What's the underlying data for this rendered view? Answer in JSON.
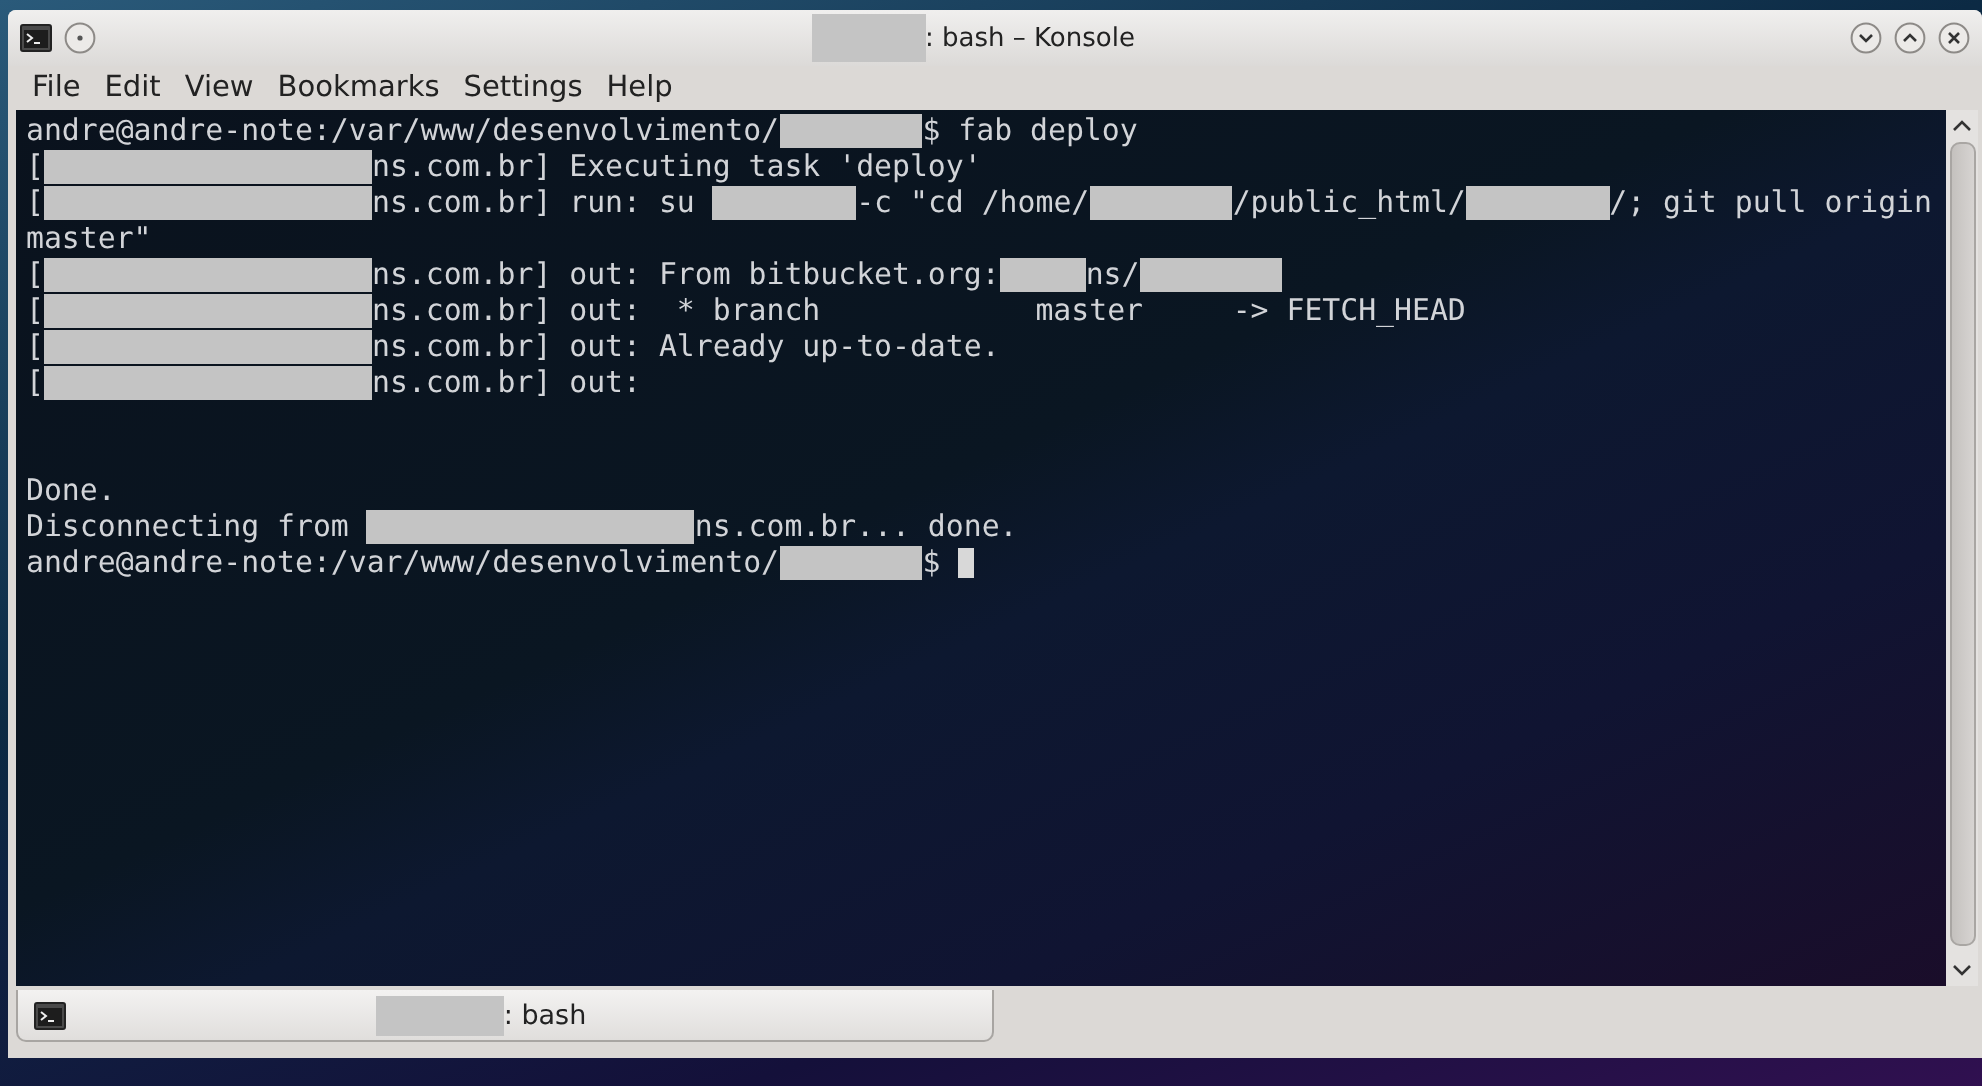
{
  "window": {
    "title": {
      "redacted": true,
      "text": ": bash – Konsole"
    }
  },
  "menu": [
    "File",
    "Edit",
    "View",
    "Bookmarks",
    "Settings",
    "Help"
  ],
  "terminal": {
    "lines": [
      {
        "kind": "text",
        "segments": [
          {
            "kind": "text",
            "text": "andre@andre-note:/var/www/desenvolvimento/"
          },
          {
            "kind": "redacted_medium"
          },
          {
            "kind": "text",
            "text": "$ fab deploy"
          }
        ]
      },
      {
        "kind": "text",
        "segments": [
          {
            "kind": "text",
            "text": "["
          },
          {
            "kind": "redacted_large"
          },
          {
            "kind": "text",
            "text": "ns.com.br] Executing task 'deploy'"
          }
        ]
      },
      {
        "kind": "text",
        "segments": [
          {
            "kind": "text",
            "text": "["
          },
          {
            "kind": "redacted_large"
          },
          {
            "kind": "text",
            "text": "ns.com.br] run: su "
          },
          {
            "kind": "redacted_medium"
          },
          {
            "kind": "text",
            "text": "-c \"cd /home/"
          },
          {
            "kind": "redacted_medium"
          },
          {
            "kind": "text",
            "text": "/public_html/"
          },
          {
            "kind": "redacted_medium"
          },
          {
            "kind": "text",
            "text": "/; git pull origin"
          }
        ]
      },
      {
        "kind": "text",
        "segments": [
          {
            "kind": "text",
            "text": "master\""
          }
        ]
      },
      {
        "kind": "text",
        "segments": [
          {
            "kind": "text",
            "text": "["
          },
          {
            "kind": "redacted_large"
          },
          {
            "kind": "text",
            "text": "ns.com.br] out: From bitbucket.org:"
          },
          {
            "kind": "redacted_small"
          },
          {
            "kind": "text",
            "text": "ns/"
          },
          {
            "kind": "redacted_medium"
          }
        ]
      },
      {
        "kind": "text",
        "segments": [
          {
            "kind": "text",
            "text": "["
          },
          {
            "kind": "redacted_large"
          },
          {
            "kind": "text",
            "text": "ns.com.br] out:  * branch            master     -> FETCH_HEAD"
          }
        ]
      },
      {
        "kind": "text",
        "segments": [
          {
            "kind": "text",
            "text": "["
          },
          {
            "kind": "redacted_large"
          },
          {
            "kind": "text",
            "text": "ns.com.br] out: Already up-to-date."
          }
        ]
      },
      {
        "kind": "text",
        "segments": [
          {
            "kind": "text",
            "text": "["
          },
          {
            "kind": "redacted_large"
          },
          {
            "kind": "text",
            "text": "ns.com.br] out:"
          }
        ]
      },
      {
        "kind": "blank"
      },
      {
        "kind": "blank"
      },
      {
        "kind": "text",
        "segments": [
          {
            "kind": "text",
            "text": "Done."
          }
        ]
      },
      {
        "kind": "text",
        "segments": [
          {
            "kind": "text",
            "text": "Disconnecting from "
          },
          {
            "kind": "redacted_large"
          },
          {
            "kind": "text",
            "text": "ns.com.br... done."
          }
        ]
      },
      {
        "kind": "text",
        "cursor": true,
        "segments": [
          {
            "kind": "text",
            "text": "andre@andre-note:/var/www/desenvolvimento/"
          },
          {
            "kind": "redacted_medium"
          },
          {
            "kind": "text",
            "text": "$ "
          }
        ]
      }
    ]
  },
  "tabs": [
    {
      "redacted": true,
      "label": ": bash",
      "selected": true
    }
  ]
}
